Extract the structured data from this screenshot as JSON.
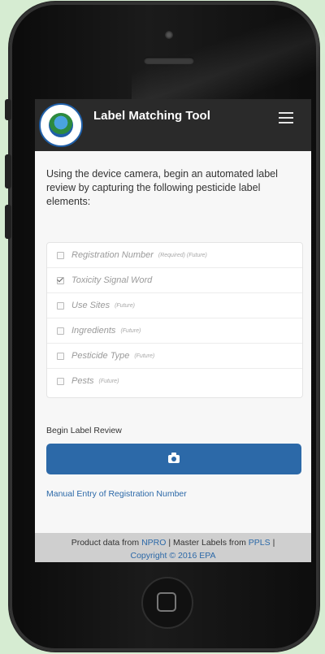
{
  "app": {
    "title": "Label Matching Tool",
    "logo_name": "epa-seal-logo",
    "menu_icon": "hamburger-menu-icon"
  },
  "intro_text": "Using the device camera, begin an automated label review by capturing the following pesticide label elements:",
  "checklist": [
    {
      "label": "Registration Number",
      "note": "(Required) (Future)",
      "checked": false
    },
    {
      "label": "Toxicity Signal Word",
      "note": "",
      "checked": true
    },
    {
      "label": "Use Sites",
      "note": "(Future)",
      "checked": false
    },
    {
      "label": "Ingredients",
      "note": "(Future)",
      "checked": false
    },
    {
      "label": "Pesticide Type",
      "note": "(Future)",
      "checked": false
    },
    {
      "label": "Pests",
      "note": "(Future)",
      "checked": false
    }
  ],
  "review": {
    "label": "Begin Label Review",
    "button_icon": "camera-icon"
  },
  "manual_entry_link": "Manual Entry of Registration Number",
  "footer": {
    "product_prefix": "Product data from",
    "npro_link": "NPRO",
    "sep1": "|",
    "master_prefix": "Master Labels from",
    "ppls_link": "PPLS",
    "sep2": "|",
    "copyright": "Copyright © 2016 EPA"
  },
  "colors": {
    "primary": "#2c69a8",
    "navbar": "#2a2a2a",
    "page_background": "#d6ecd2"
  }
}
